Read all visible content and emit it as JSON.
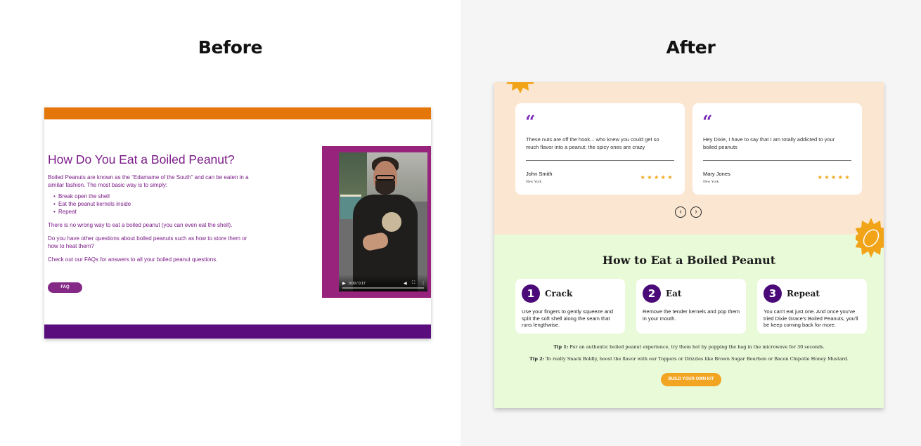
{
  "before": {
    "heading": "Before",
    "title": "How Do You Eat a Boiled Peanut?",
    "intro": "Boiled Peanuts are known as the “Edamame of the South” and can be eaten in a similar fashion. The most basic way is to simply:",
    "steps": [
      "Break open the shell",
      "Eat the peanut kernels inside",
      "Repeat"
    ],
    "no_wrong_way": "There is no wrong way to eat a boiled peanut (you can even eat the shell).",
    "other_questions": "Do you have other questions about boiled peanuts such as how to store them or how to heat them?",
    "check_faqs": "Check out our FAQs for answers to all your boiled peanut questions.",
    "faq_button": "FAQ",
    "video": {
      "play_icon": "play-icon",
      "time": "0:00 / 0:17",
      "volume_icon": "volume-icon",
      "fullscreen_icon": "fullscreen-icon",
      "menu_icon": "more-icon"
    },
    "colors": {
      "orange": "#e5760a",
      "purple": "#5a0e7e",
      "text": "#7a1b86",
      "video_frame": "#97237c"
    }
  },
  "after": {
    "heading": "After",
    "reviews": [
      {
        "quote_icon": "quote-icon",
        "text": "These nuts are off the hook... who knew you could get so much flavor into a peanut; the spicy ones are crazy",
        "name": "John Smith",
        "location": "New York",
        "rating": 5,
        "stars": "★★★★★"
      },
      {
        "quote_icon": "quote-icon",
        "text": "Hey Dixie, I have to say that I am totally addicted to your boiled peanuts",
        "name": "Mary Jones",
        "location": "New York",
        "rating": 5,
        "stars": "★★★★★"
      }
    ],
    "carousel": {
      "prev": "‹",
      "next": "›"
    },
    "howto_title": "How to Eat a Boiled Peanut",
    "steps": [
      {
        "number": "1",
        "title": "Crack",
        "text": "Use your fingers to gently squeeze and split the soft shell along the seam that runs lengthwise."
      },
      {
        "number": "2",
        "title": "Eat",
        "text": "Remove the tender kernels and pop them in your mouth."
      },
      {
        "number": "3",
        "title": "Repeat",
        "text": "You can't eat just one. And once you've tried Dixie Grace's Boiled Peanuts, you'll be keep coming back for more."
      }
    ],
    "tips": [
      {
        "label": "Tip 1:",
        "text": " For an authentic boiled peanut experience, try them hot by popping the bag in the microwave for 30 seconds."
      },
      {
        "label": "Tip 2:",
        "text": " To really Snack Boldly, boost the flavor with our Toppers or Drizzles like Brown Sugar Bourbon or Bacon Chipotle Honey Mustard."
      }
    ],
    "build_kit_button": "BUILD YOUR OWN KIT",
    "colors": {
      "reviews_bg": "#fbe7d1",
      "howto_bg": "#e9fad8",
      "accent_purple": "#4a0b78",
      "quote_purple": "#7a2dbb",
      "star": "#f0a20e",
      "button": "#f1a522"
    }
  }
}
